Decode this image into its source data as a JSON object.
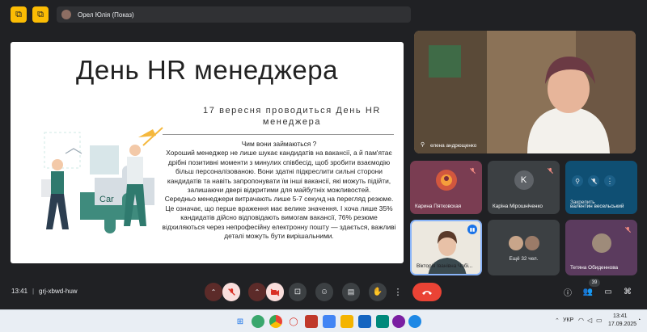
{
  "meeting": {
    "presenter_label": "Орел Юлія (Показ)",
    "time": "13:41",
    "code": "grj-xbwd-huw",
    "participant_count": "39"
  },
  "slide": {
    "title": "День HR менеджера",
    "subtitle": "17 вересня проводиться День HR менеджера",
    "body": [
      "Чим вони займаються ?",
      "Хороший менеджер не лише шукає кандидатів на вакансії, а й пам'ятає дрібні позитивні моменти з минулих співбесід, щоб зробити взаємодію більш персоналізованою. Вони здатні підкреслити сильні сторони кандидатів та навіть запропонувати їм інші вакансії, які можуть підійти, залишаючи двері відкритими для майбутніх можливостей.",
      "Середньо менеджери витрачають лише 5-7 секунд на перегляд резюме. Це означає, що перше враження має велике значення. І хоча лише 35% кандидатів дійсно відповідають вимогам вакансії, 76% резюме відхиляються через непрофесійну електронну пошту — здається, важливі деталі можуть бути вирішальними."
    ]
  },
  "participants": {
    "speaker": {
      "name": "елена андрющенко"
    },
    "tiles": [
      {
        "name": "Карина Пятковская",
        "bg": "#7a3d52"
      },
      {
        "name": "Каріна Мірошніченко",
        "initial": "K",
        "bg": "#3c4043"
      },
      {
        "name": "валентин весельський",
        "tooltip": "Закрепить",
        "bg": "#0f4f73"
      },
      {
        "name": "Вікторія Іванівна Чобі...",
        "bg": "#e8e4dc"
      },
      {
        "more_label": "Ещё 32 чел.",
        "bg": "#3c4043"
      },
      {
        "name": "Тетяна Обиденнова",
        "bg": "#5b3b5e"
      }
    ]
  },
  "taskbar": {
    "lang": "УКР",
    "time": "13:41",
    "date": "17.09.2025"
  },
  "colors": {
    "accent": "#fbbc04",
    "end_call": "#ea4335",
    "background": "#202124"
  }
}
